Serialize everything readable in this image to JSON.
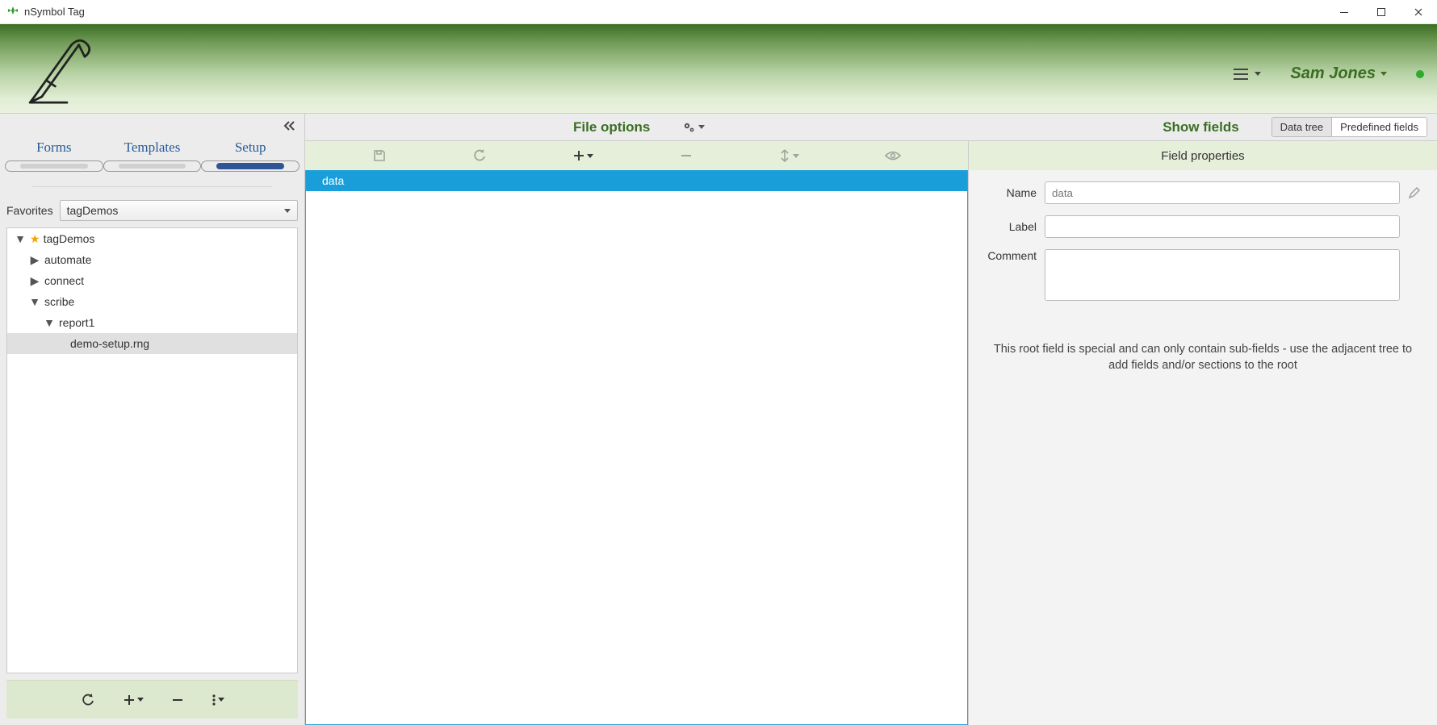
{
  "window": {
    "title": "nSymbol Tag"
  },
  "header": {
    "user_name": "Sam Jones"
  },
  "left": {
    "tabs": {
      "forms": "Forms",
      "templates": "Templates",
      "setup": "Setup",
      "active": "setup"
    },
    "favorites_label": "Favorites",
    "favorites_value": "tagDemos",
    "tree": {
      "root": "tagDemos",
      "items": [
        {
          "label": "automate",
          "expanded": false
        },
        {
          "label": "connect",
          "expanded": false
        },
        {
          "label": "scribe",
          "expanded": true,
          "children": [
            {
              "label": "report1",
              "expanded": true,
              "children": [
                {
                  "label": "demo-setup.rng",
                  "selected": true
                }
              ]
            }
          ]
        }
      ]
    }
  },
  "subbar": {
    "file_options": "File options",
    "show_fields": "Show fields",
    "seg": {
      "data_tree": "Data tree",
      "predefined": "Predefined fields",
      "active": "data_tree"
    }
  },
  "center": {
    "root_field": "data"
  },
  "right": {
    "title": "Field properties",
    "name_label": "Name",
    "name_value": "data",
    "label_label": "Label",
    "label_value": "",
    "comment_label": "Comment",
    "comment_value": "",
    "help": "This root field is special and can only contain sub-fields - use the adjacent tree to add fields and/or sections to the root"
  }
}
